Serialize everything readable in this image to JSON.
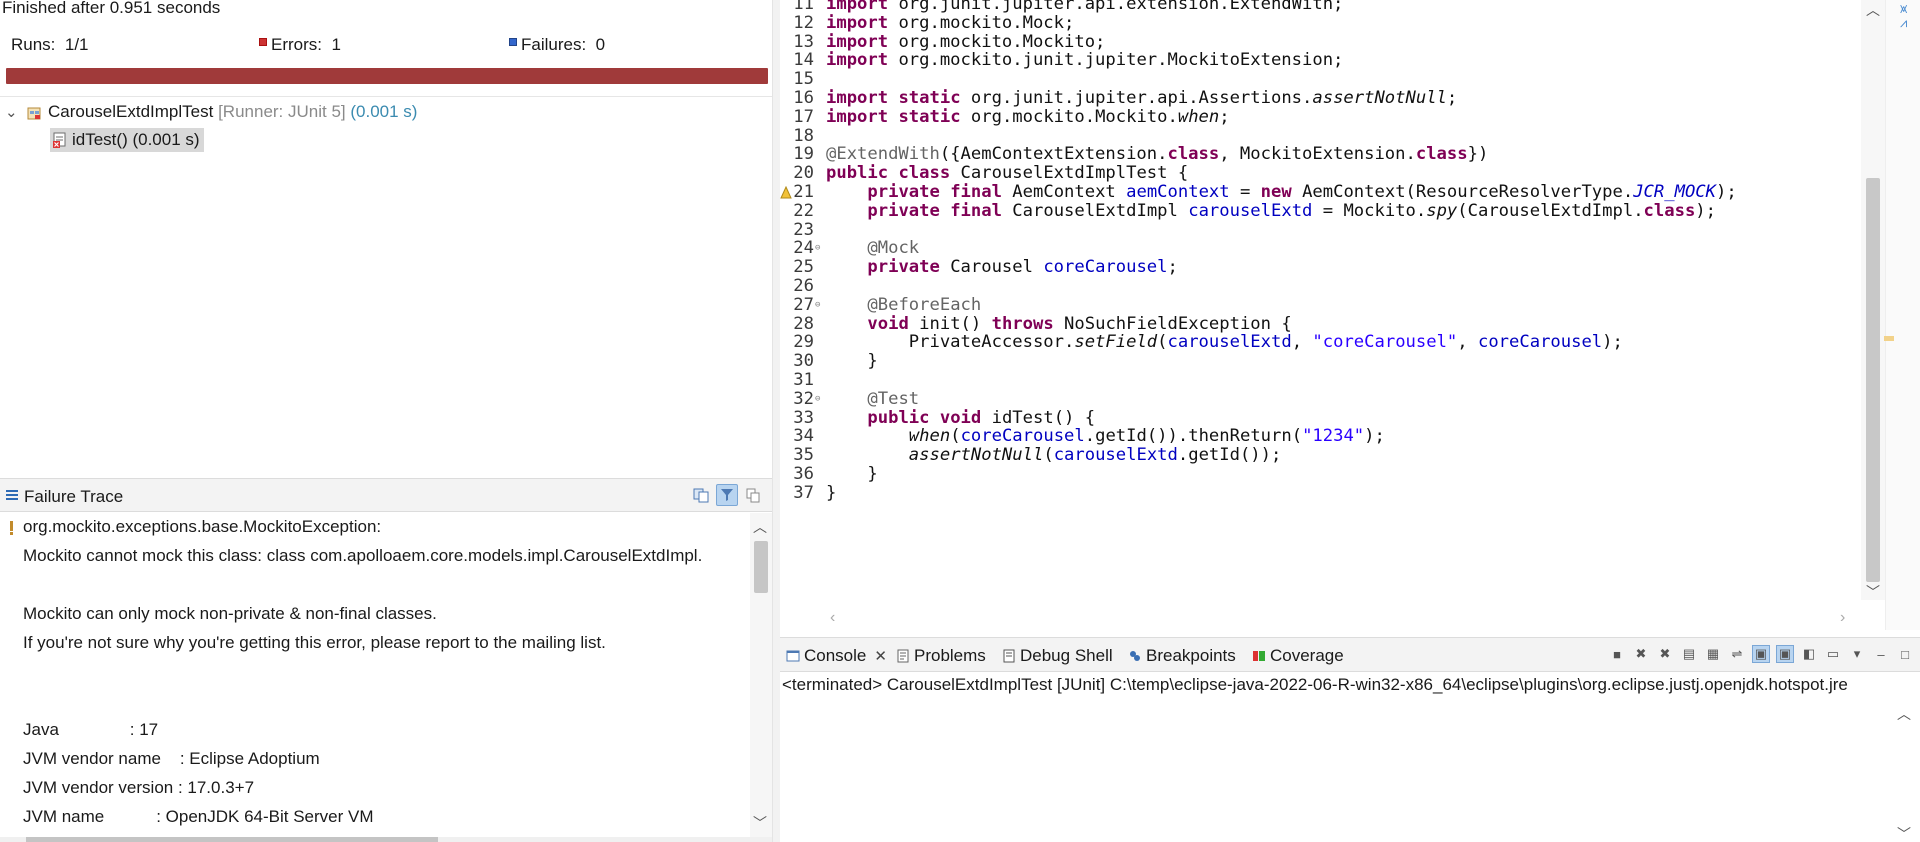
{
  "junit": {
    "status": "Finished after 0.951 seconds",
    "runs_label": "Runs:",
    "runs_value": "1/1",
    "errors_label": "Errors:",
    "errors_value": "1",
    "failures_label": "Failures:",
    "failures_value": "0",
    "progress_color": "#a03a3a",
    "tree": {
      "root_name": "CarouselExtdImplTest",
      "root_runner": "[Runner: JUnit 5]",
      "root_time": "(0.001 s)",
      "child_label": "idTest() (0.001 s)"
    }
  },
  "failure_trace": {
    "title": "Failure Trace",
    "lines": [
      "org.mockito.exceptions.base.MockitoException:",
      "Mockito cannot mock this class: class com.apolloaem.core.models.impl.CarouselExtdImpl.",
      "",
      "Mockito can only mock non-private & non-final classes.",
      "If you're not sure why you're getting this error, please report to the mailing list.",
      "",
      "",
      "Java               : 17",
      "JVM vendor name    : Eclipse Adoptium",
      "JVM vendor version : 17.0.3+7",
      "JVM name           : OpenJDK 64-Bit Server VM"
    ]
  },
  "editor": {
    "lines": [
      {
        "n": "11",
        "html": "<span class=\"kw\">import</span> org.junit.jupiter.api.extension.ExtendWith;"
      },
      {
        "n": "12",
        "html": "<span class=\"kw\">import</span> org.mockito.Mock;"
      },
      {
        "n": "13",
        "html": "<span class=\"kw\">import</span> org.mockito.Mockito;"
      },
      {
        "n": "14",
        "html": "<span class=\"kw\">import</span> org.mockito.junit.jupiter.MockitoExtension;"
      },
      {
        "n": "15",
        "html": ""
      },
      {
        "n": "16",
        "html": "<span class=\"kw\">import</span> <span class=\"kw\">static</span> org.junit.jupiter.api.Assertions.<span class=\"it\">assertNotNull</span>;"
      },
      {
        "n": "17",
        "html": "<span class=\"kw\">import</span> <span class=\"kw\">static</span> org.mockito.Mockito.<span class=\"it\">when</span>;"
      },
      {
        "n": "18",
        "html": ""
      },
      {
        "n": "19",
        "html": "<span class=\"an\">@ExtendWith</span>({AemContextExtension.<span class=\"kw\">class</span>, MockitoExtension.<span class=\"kw\">class</span>})"
      },
      {
        "n": "20",
        "html": "<span class=\"kw\">public</span> <span class=\"kw\">class</span> CarouselExtdImplTest {"
      },
      {
        "n": "21",
        "html": "    <span class=\"kw\">private</span> <span class=\"kw\">final</span> AemContext <span class=\"fld\">aemContext</span> = <span class=\"kw\">new</span> AemContext(ResourceResolverType.<span class=\"st\">JCR_MOCK</span>);",
        "warn": true
      },
      {
        "n": "22",
        "html": "    <span class=\"kw\">private</span> <span class=\"kw\">final</span> CarouselExtdImpl <span class=\"fld\">carouselExtd</span> = Mockito.<span class=\"it\">spy</span>(CarouselExtdImpl.<span class=\"kw\">class</span>);"
      },
      {
        "n": "23",
        "html": ""
      },
      {
        "n": "24",
        "html": "    <span class=\"an\">@Mock</span>",
        "fold": true
      },
      {
        "n": "25",
        "html": "    <span class=\"kw\">private</span> Carousel <span class=\"fld\">coreCarousel</span>;"
      },
      {
        "n": "26",
        "html": ""
      },
      {
        "n": "27",
        "html": "    <span class=\"an\">@BeforeEach</span>",
        "fold": true
      },
      {
        "n": "28",
        "html": "    <span class=\"kw\">void</span> init() <span class=\"kw\">throws</span> NoSuchFieldException {"
      },
      {
        "n": "29",
        "html": "        PrivateAccessor.<span class=\"it\">setField</span>(<span class=\"fld\">carouselExtd</span>, <span class=\"str\">\"coreCarousel\"</span>, <span class=\"fld\">coreCarousel</span>);"
      },
      {
        "n": "30",
        "html": "    }"
      },
      {
        "n": "31",
        "html": ""
      },
      {
        "n": "32",
        "html": "    <span class=\"an\">@Test</span>",
        "fold": true
      },
      {
        "n": "33",
        "html": "    <span class=\"kw\">public</span> <span class=\"kw\">void</span> idTest() {"
      },
      {
        "n": "34",
        "html": "        <span class=\"it\">when</span>(<span class=\"fld\">coreCarousel</span>.getId()).thenReturn(<span class=\"str\">\"1234\"</span>);"
      },
      {
        "n": "35",
        "html": "        <span class=\"it\">assertNotNull</span>(<span class=\"fld\">carouselExtd</span>.getId());"
      },
      {
        "n": "36",
        "html": "    }"
      },
      {
        "n": "37",
        "html": "}"
      }
    ]
  },
  "console": {
    "tabs": [
      {
        "label": "Console",
        "icon": "console-icon"
      },
      {
        "label": "Problems",
        "icon": "problems-icon"
      },
      {
        "label": "Debug Shell",
        "icon": "debug-shell-icon"
      },
      {
        "label": "Breakpoints",
        "icon": "breakpoints-icon"
      },
      {
        "label": "Coverage",
        "icon": "coverage-icon"
      }
    ],
    "launch_line": "<terminated> CarouselExtdImplTest [JUnit] C:\\temp\\eclipse-java-2022-06-R-win32-x86_64\\eclipse\\plugins\\org.eclipse.justj.openjdk.hotspot.jre"
  }
}
